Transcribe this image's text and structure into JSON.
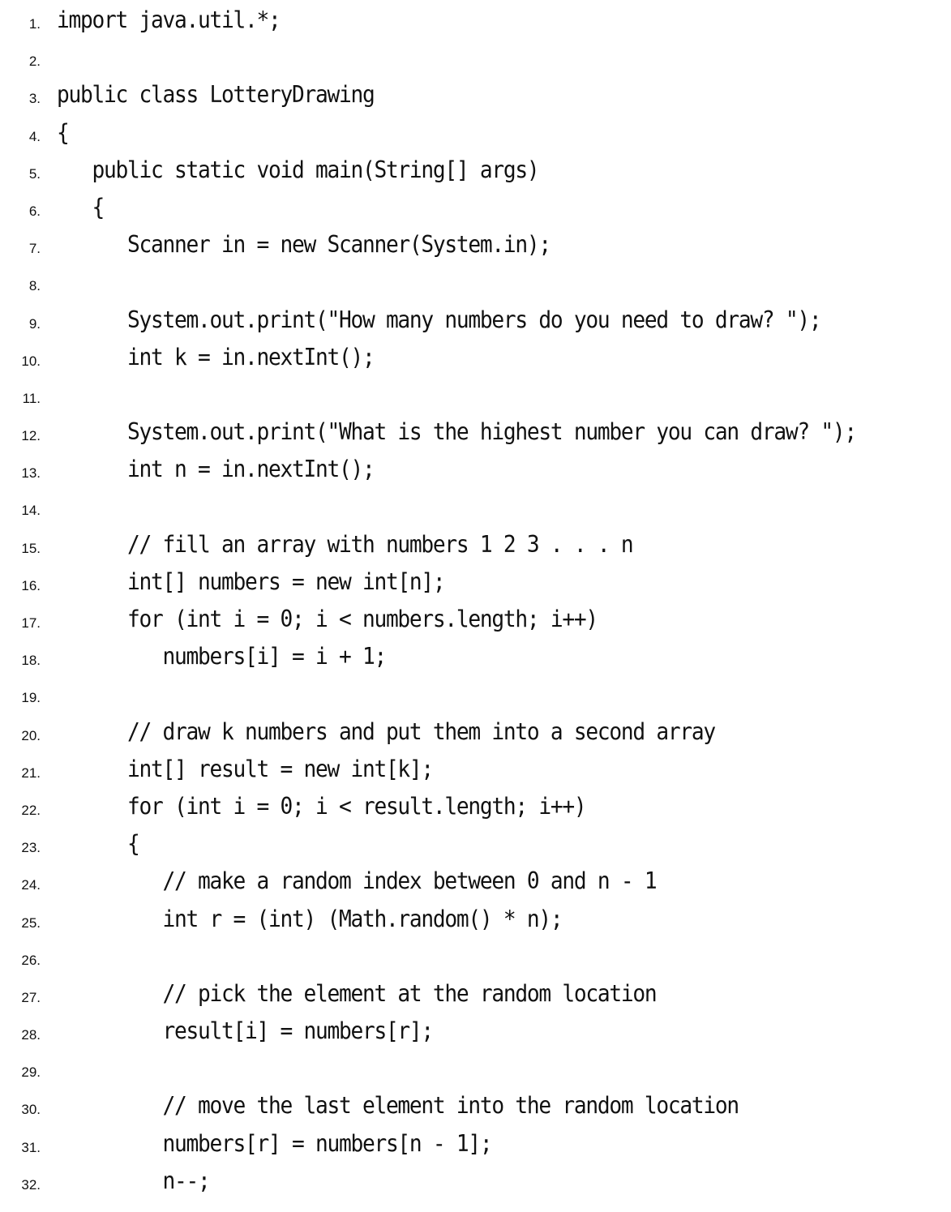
{
  "lines": [
    {
      "n": "1.",
      "code": "import java.util.*;"
    },
    {
      "n": "2.",
      "code": ""
    },
    {
      "n": "3.",
      "code": "public class LotteryDrawing"
    },
    {
      "n": "4.",
      "code": "{"
    },
    {
      "n": "5.",
      "code": "   public static void main(String[] args)"
    },
    {
      "n": "6.",
      "code": "   {"
    },
    {
      "n": "7.",
      "code": "      Scanner in = new Scanner(System.in);"
    },
    {
      "n": "8.",
      "code": ""
    },
    {
      "n": "9.",
      "code": "      System.out.print(\"How many numbers do you need to draw? \");"
    },
    {
      "n": "10.",
      "code": "      int k = in.nextInt();"
    },
    {
      "n": "11.",
      "code": ""
    },
    {
      "n": "12.",
      "code": "      System.out.print(\"What is the highest number you can draw? \");"
    },
    {
      "n": "13.",
      "code": "      int n = in.nextInt();"
    },
    {
      "n": "14.",
      "code": ""
    },
    {
      "n": "15.",
      "code": "      // fill an array with numbers 1 2 3 . . . n"
    },
    {
      "n": "16.",
      "code": "      int[] numbers = new int[n];"
    },
    {
      "n": "17.",
      "code": "      for (int i = 0; i < numbers.length; i++)"
    },
    {
      "n": "18.",
      "code": "         numbers[i] = i + 1;"
    },
    {
      "n": "19.",
      "code": ""
    },
    {
      "n": "20.",
      "code": "      // draw k numbers and put them into a second array"
    },
    {
      "n": "21.",
      "code": "      int[] result = new int[k];"
    },
    {
      "n": "22.",
      "code": "      for (int i = 0; i < result.length; i++)"
    },
    {
      "n": "23.",
      "code": "      {"
    },
    {
      "n": "24.",
      "code": "         // make a random index between 0 and n - 1"
    },
    {
      "n": "25.",
      "code": "         int r = (int) (Math.random() * n);"
    },
    {
      "n": "26.",
      "code": ""
    },
    {
      "n": "27.",
      "code": "         // pick the element at the random location"
    },
    {
      "n": "28.",
      "code": "         result[i] = numbers[r];"
    },
    {
      "n": "29.",
      "code": ""
    },
    {
      "n": "30.",
      "code": "         // move the last element into the random location"
    },
    {
      "n": "31.",
      "code": "         numbers[r] = numbers[n - 1];"
    },
    {
      "n": "32.",
      "code": "         n--;"
    }
  ]
}
